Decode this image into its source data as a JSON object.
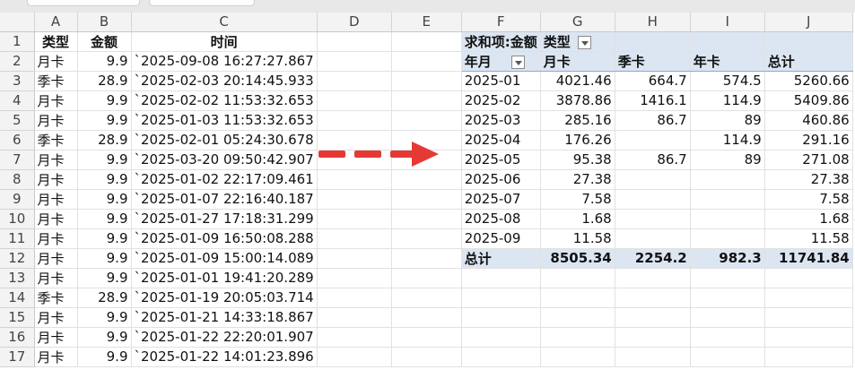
{
  "columns": [
    "",
    "A",
    "B",
    "C",
    "D",
    "E",
    "F",
    "G",
    "H",
    "I",
    "J"
  ],
  "row_numbers": [
    "1",
    "2",
    "3",
    "4",
    "5",
    "6",
    "7",
    "8",
    "9",
    "10",
    "11",
    "12",
    "13",
    "14",
    "15",
    "16",
    "17"
  ],
  "source": {
    "headers": [
      "类型",
      "金额",
      "时间"
    ],
    "rows": [
      [
        "月卡",
        "9.9",
        "`2025-09-08 16:27:27.867"
      ],
      [
        "季卡",
        "28.9",
        "`2025-02-03 20:14:45.933"
      ],
      [
        "月卡",
        "9.9",
        "`2025-02-02 11:53:32.653"
      ],
      [
        "月卡",
        "9.9",
        "`2025-01-03 11:53:32.653"
      ],
      [
        "季卡",
        "28.9",
        "`2025-02-01 05:24:30.678"
      ],
      [
        "月卡",
        "9.9",
        "`2025-03-20 09:50:42.907"
      ],
      [
        "月卡",
        "9.9",
        "`2025-01-02 22:17:09.461"
      ],
      [
        "月卡",
        "9.9",
        "`2025-01-07 22:16:40.187"
      ],
      [
        "月卡",
        "9.9",
        "`2025-01-27 17:18:31.299"
      ],
      [
        "月卡",
        "9.9",
        "`2025-01-09 16:50:08.288"
      ],
      [
        "月卡",
        "9.9",
        "`2025-01-09 15:00:14.089"
      ],
      [
        "月卡",
        "9.9",
        "`2025-01-01 19:41:20.289"
      ],
      [
        "季卡",
        "28.9",
        "`2025-01-19 20:05:03.714"
      ],
      [
        "月卡",
        "9.9",
        "`2025-01-21 14:33:18.867"
      ],
      [
        "月卡",
        "9.9",
        "`2025-01-22 22:20:01.907"
      ],
      [
        "月卡",
        "9.9",
        "`2025-01-22 14:01:23.896"
      ]
    ]
  },
  "pivot": {
    "value_label": "求和项:金额",
    "col_field": "类型",
    "row_field": "年月",
    "col_headers": [
      "月卡",
      "季卡",
      "年卡",
      "总计"
    ],
    "rows": [
      [
        "2025-01",
        "4021.46",
        "664.7",
        "574.5",
        "5260.66"
      ],
      [
        "2025-02",
        "3878.86",
        "1416.1",
        "114.9",
        "5409.86"
      ],
      [
        "2025-03",
        "285.16",
        "86.7",
        "89",
        "460.86"
      ],
      [
        "2025-04",
        "176.26",
        "",
        "114.9",
        "291.16"
      ],
      [
        "2025-05",
        "95.38",
        "86.7",
        "89",
        "271.08"
      ],
      [
        "2025-06",
        "27.38",
        "",
        "",
        "27.38"
      ],
      [
        "2025-07",
        "7.58",
        "",
        "",
        "7.58"
      ],
      [
        "2025-08",
        "1.68",
        "",
        "",
        "1.68"
      ],
      [
        "2025-09",
        "11.58",
        "",
        "",
        "11.58"
      ]
    ],
    "total": [
      "总计",
      "8505.34",
      "2254.2",
      "982.3",
      "11741.84"
    ]
  },
  "colors": {
    "pivot_fill": "#dce6f2",
    "arrow": "#e53935",
    "header_bg": "#f3f3f3"
  },
  "icons": {
    "filter_dropdown": "chevron-down-icon",
    "transform_arrow": "dashed-arrow-icon"
  }
}
